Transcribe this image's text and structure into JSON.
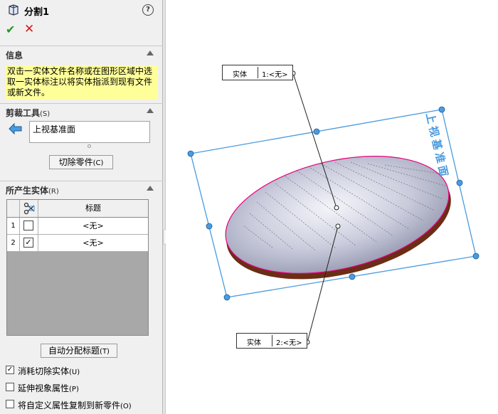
{
  "header": {
    "title": "分割1",
    "help": "?",
    "ok": "✔",
    "cancel": "✕"
  },
  "info": {
    "heading": "信息",
    "text": "双击一实体文件名称或在图形区域中选取一实体标注以将实体指派到现有文件或新文件。"
  },
  "trim": {
    "heading": "剪裁工具",
    "heading_key": "(S)",
    "field_value": "上视基准面",
    "button_label": "切除零件",
    "button_key": "(C)"
  },
  "bodies": {
    "heading": "所产生实体",
    "heading_key": "(R)",
    "column_title": "标题",
    "rows": [
      {
        "num": "1",
        "checked": false,
        "title": "<无>"
      },
      {
        "num": "2",
        "checked": true,
        "title": "<无>"
      }
    ],
    "auto_button_label": "自动分配标题",
    "auto_button_key": "(T)"
  },
  "options": [
    {
      "label": "消耗切除实体",
      "key": "(U)",
      "checked": true
    },
    {
      "label": "延伸视象属性",
      "key": "(P)",
      "checked": false
    },
    {
      "label": "将自定义属性复制到新零件",
      "key": "(O)",
      "checked": false
    }
  ],
  "viewport": {
    "plane_label": "上视基准面",
    "callout1": {
      "label": "实体",
      "value": "1:<无>"
    },
    "callout2": {
      "label": "实体",
      "value": "2:<无>"
    }
  },
  "colors": {
    "plane": "#4a9be0",
    "ok": "#1f9a1f",
    "cancel": "#d81818",
    "info_bg": "#ffff99"
  }
}
